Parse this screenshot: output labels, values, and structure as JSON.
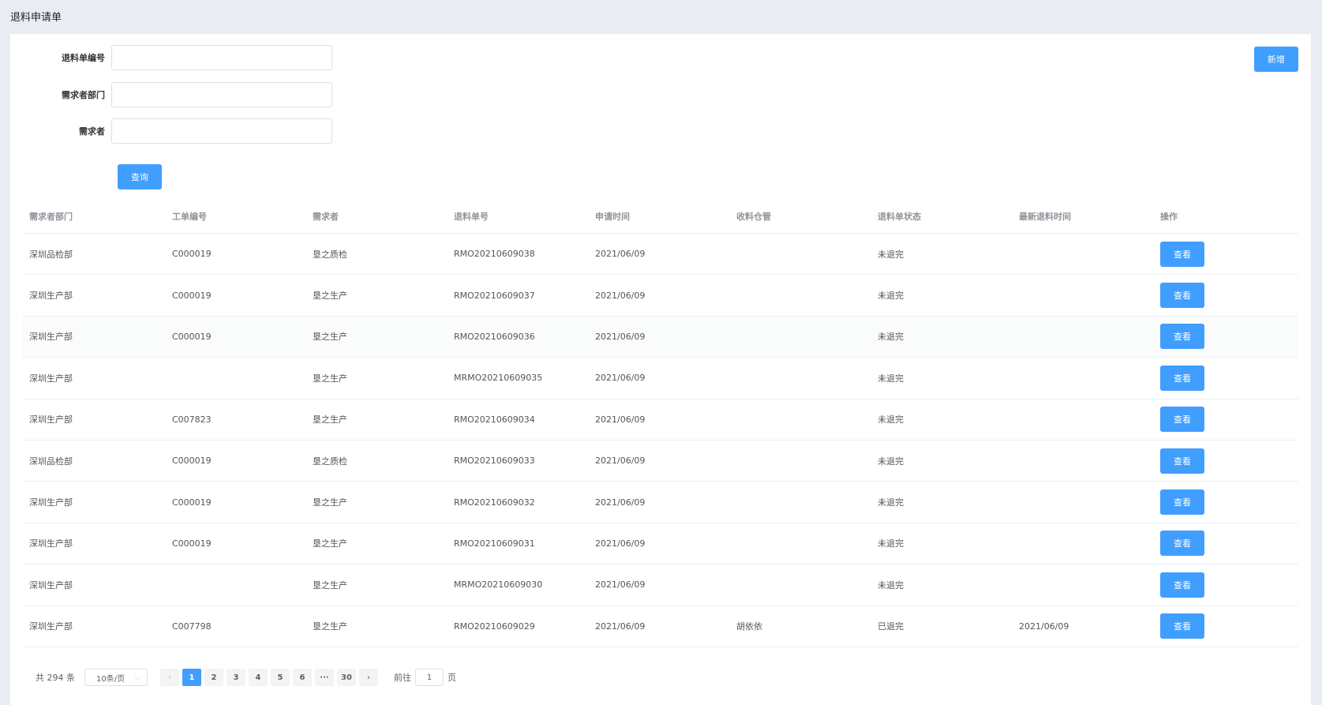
{
  "page": {
    "title": "退料申请单"
  },
  "filters": {
    "return_no_label": "退料单编号",
    "return_no_value": "",
    "dept_label": "需求者部门",
    "dept_value": "",
    "requester_label": "需求者",
    "requester_value": "",
    "query_button": "查询"
  },
  "toolbar": {
    "add_button": "新增"
  },
  "table": {
    "columns": [
      "需求者部门",
      "工单编号",
      "需求者",
      "退料单号",
      "申请时间",
      "收料仓管",
      "退料单状态",
      "最新退料时间",
      "操作"
    ],
    "action_label": "查看",
    "rows": [
      [
        "深圳品检部",
        "C000019",
        "垦之质检",
        "RMO20210609038",
        "2021/06/09",
        "",
        "未退完",
        ""
      ],
      [
        "深圳生产部",
        "C000019",
        "垦之生产",
        "RMO20210609037",
        "2021/06/09",
        "",
        "未退完",
        ""
      ],
      [
        "深圳生产部",
        "C000019",
        "垦之生产",
        "RMO20210609036",
        "2021/06/09",
        "",
        "未退完",
        ""
      ],
      [
        "深圳生产部",
        "",
        "垦之生产",
        "MRMO20210609035",
        "2021/06/09",
        "",
        "未退完",
        ""
      ],
      [
        "深圳生产部",
        "C007823",
        "垦之生产",
        "RMO20210609034",
        "2021/06/09",
        "",
        "未退完",
        ""
      ],
      [
        "深圳品检部",
        "C000019",
        "垦之质检",
        "RMO20210609033",
        "2021/06/09",
        "",
        "未退完",
        ""
      ],
      [
        "深圳生产部",
        "C000019",
        "垦之生产",
        "RMO20210609032",
        "2021/06/09",
        "",
        "未退完",
        ""
      ],
      [
        "深圳生产部",
        "C000019",
        "垦之生产",
        "RMO20210609031",
        "2021/06/09",
        "",
        "未退完",
        ""
      ],
      [
        "深圳生产部",
        "",
        "垦之生产",
        "MRMO20210609030",
        "2021/06/09",
        "",
        "未退完",
        ""
      ],
      [
        "深圳生产部",
        "C007798",
        "垦之生产",
        "RMO20210609029",
        "2021/06/09",
        "胡依依",
        "已退完",
        "2021/06/09"
      ]
    ]
  },
  "pagination": {
    "total_text": "共 294 条",
    "page_size": "10条/页",
    "prev_icon": "chevron-left-icon",
    "pages": [
      "1",
      "2",
      "3",
      "4",
      "5",
      "6",
      "···",
      "30"
    ],
    "current_page": "1",
    "next_icon": "chevron-right-icon",
    "goto_prefix": "前往",
    "goto_value": "1",
    "goto_suffix": "页"
  },
  "colors": {
    "primary": "#409eff",
    "background": "#e9edf3",
    "border": "#ebeef5"
  }
}
